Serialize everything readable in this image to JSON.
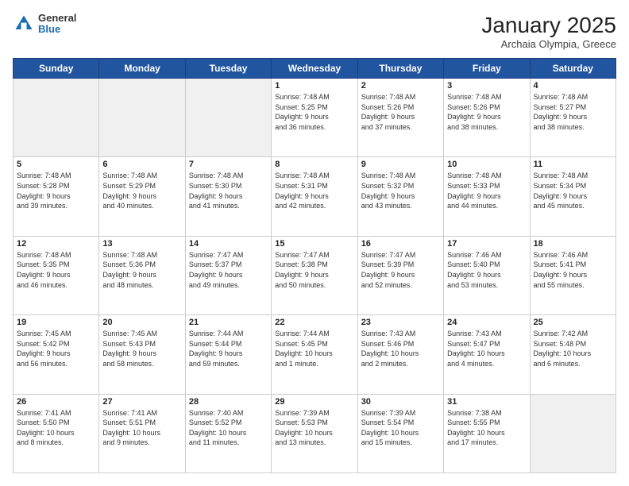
{
  "header": {
    "logo": {
      "general": "General",
      "blue": "Blue"
    },
    "title": "January 2025",
    "subtitle": "Archaia Olympia, Greece"
  },
  "weekdays": [
    "Sunday",
    "Monday",
    "Tuesday",
    "Wednesday",
    "Thursday",
    "Friday",
    "Saturday"
  ],
  "weeks": [
    [
      {
        "day": "",
        "info": ""
      },
      {
        "day": "",
        "info": ""
      },
      {
        "day": "",
        "info": ""
      },
      {
        "day": "1",
        "info": "Sunrise: 7:48 AM\nSunset: 5:25 PM\nDaylight: 9 hours\nand 36 minutes."
      },
      {
        "day": "2",
        "info": "Sunrise: 7:48 AM\nSunset: 5:26 PM\nDaylight: 9 hours\nand 37 minutes."
      },
      {
        "day": "3",
        "info": "Sunrise: 7:48 AM\nSunset: 5:26 PM\nDaylight: 9 hours\nand 38 minutes."
      },
      {
        "day": "4",
        "info": "Sunrise: 7:48 AM\nSunset: 5:27 PM\nDaylight: 9 hours\nand 38 minutes."
      }
    ],
    [
      {
        "day": "5",
        "info": "Sunrise: 7:48 AM\nSunset: 5:28 PM\nDaylight: 9 hours\nand 39 minutes."
      },
      {
        "day": "6",
        "info": "Sunrise: 7:48 AM\nSunset: 5:29 PM\nDaylight: 9 hours\nand 40 minutes."
      },
      {
        "day": "7",
        "info": "Sunrise: 7:48 AM\nSunset: 5:30 PM\nDaylight: 9 hours\nand 41 minutes."
      },
      {
        "day": "8",
        "info": "Sunrise: 7:48 AM\nSunset: 5:31 PM\nDaylight: 9 hours\nand 42 minutes."
      },
      {
        "day": "9",
        "info": "Sunrise: 7:48 AM\nSunset: 5:32 PM\nDaylight: 9 hours\nand 43 minutes."
      },
      {
        "day": "10",
        "info": "Sunrise: 7:48 AM\nSunset: 5:33 PM\nDaylight: 9 hours\nand 44 minutes."
      },
      {
        "day": "11",
        "info": "Sunrise: 7:48 AM\nSunset: 5:34 PM\nDaylight: 9 hours\nand 45 minutes."
      }
    ],
    [
      {
        "day": "12",
        "info": "Sunrise: 7:48 AM\nSunset: 5:35 PM\nDaylight: 9 hours\nand 46 minutes."
      },
      {
        "day": "13",
        "info": "Sunrise: 7:48 AM\nSunset: 5:36 PM\nDaylight: 9 hours\nand 48 minutes."
      },
      {
        "day": "14",
        "info": "Sunrise: 7:47 AM\nSunset: 5:37 PM\nDaylight: 9 hours\nand 49 minutes."
      },
      {
        "day": "15",
        "info": "Sunrise: 7:47 AM\nSunset: 5:38 PM\nDaylight: 9 hours\nand 50 minutes."
      },
      {
        "day": "16",
        "info": "Sunrise: 7:47 AM\nSunset: 5:39 PM\nDaylight: 9 hours\nand 52 minutes."
      },
      {
        "day": "17",
        "info": "Sunrise: 7:46 AM\nSunset: 5:40 PM\nDaylight: 9 hours\nand 53 minutes."
      },
      {
        "day": "18",
        "info": "Sunrise: 7:46 AM\nSunset: 5:41 PM\nDaylight: 9 hours\nand 55 minutes."
      }
    ],
    [
      {
        "day": "19",
        "info": "Sunrise: 7:45 AM\nSunset: 5:42 PM\nDaylight: 9 hours\nand 56 minutes."
      },
      {
        "day": "20",
        "info": "Sunrise: 7:45 AM\nSunset: 5:43 PM\nDaylight: 9 hours\nand 58 minutes."
      },
      {
        "day": "21",
        "info": "Sunrise: 7:44 AM\nSunset: 5:44 PM\nDaylight: 9 hours\nand 59 minutes."
      },
      {
        "day": "22",
        "info": "Sunrise: 7:44 AM\nSunset: 5:45 PM\nDaylight: 10 hours\nand 1 minute."
      },
      {
        "day": "23",
        "info": "Sunrise: 7:43 AM\nSunset: 5:46 PM\nDaylight: 10 hours\nand 2 minutes."
      },
      {
        "day": "24",
        "info": "Sunrise: 7:43 AM\nSunset: 5:47 PM\nDaylight: 10 hours\nand 4 minutes."
      },
      {
        "day": "25",
        "info": "Sunrise: 7:42 AM\nSunset: 5:48 PM\nDaylight: 10 hours\nand 6 minutes."
      }
    ],
    [
      {
        "day": "26",
        "info": "Sunrise: 7:41 AM\nSunset: 5:50 PM\nDaylight: 10 hours\nand 8 minutes."
      },
      {
        "day": "27",
        "info": "Sunrise: 7:41 AM\nSunset: 5:51 PM\nDaylight: 10 hours\nand 9 minutes."
      },
      {
        "day": "28",
        "info": "Sunrise: 7:40 AM\nSunset: 5:52 PM\nDaylight: 10 hours\nand 11 minutes."
      },
      {
        "day": "29",
        "info": "Sunrise: 7:39 AM\nSunset: 5:53 PM\nDaylight: 10 hours\nand 13 minutes."
      },
      {
        "day": "30",
        "info": "Sunrise: 7:39 AM\nSunset: 5:54 PM\nDaylight: 10 hours\nand 15 minutes."
      },
      {
        "day": "31",
        "info": "Sunrise: 7:38 AM\nSunset: 5:55 PM\nDaylight: 10 hours\nand 17 minutes."
      },
      {
        "day": "",
        "info": ""
      }
    ]
  ]
}
